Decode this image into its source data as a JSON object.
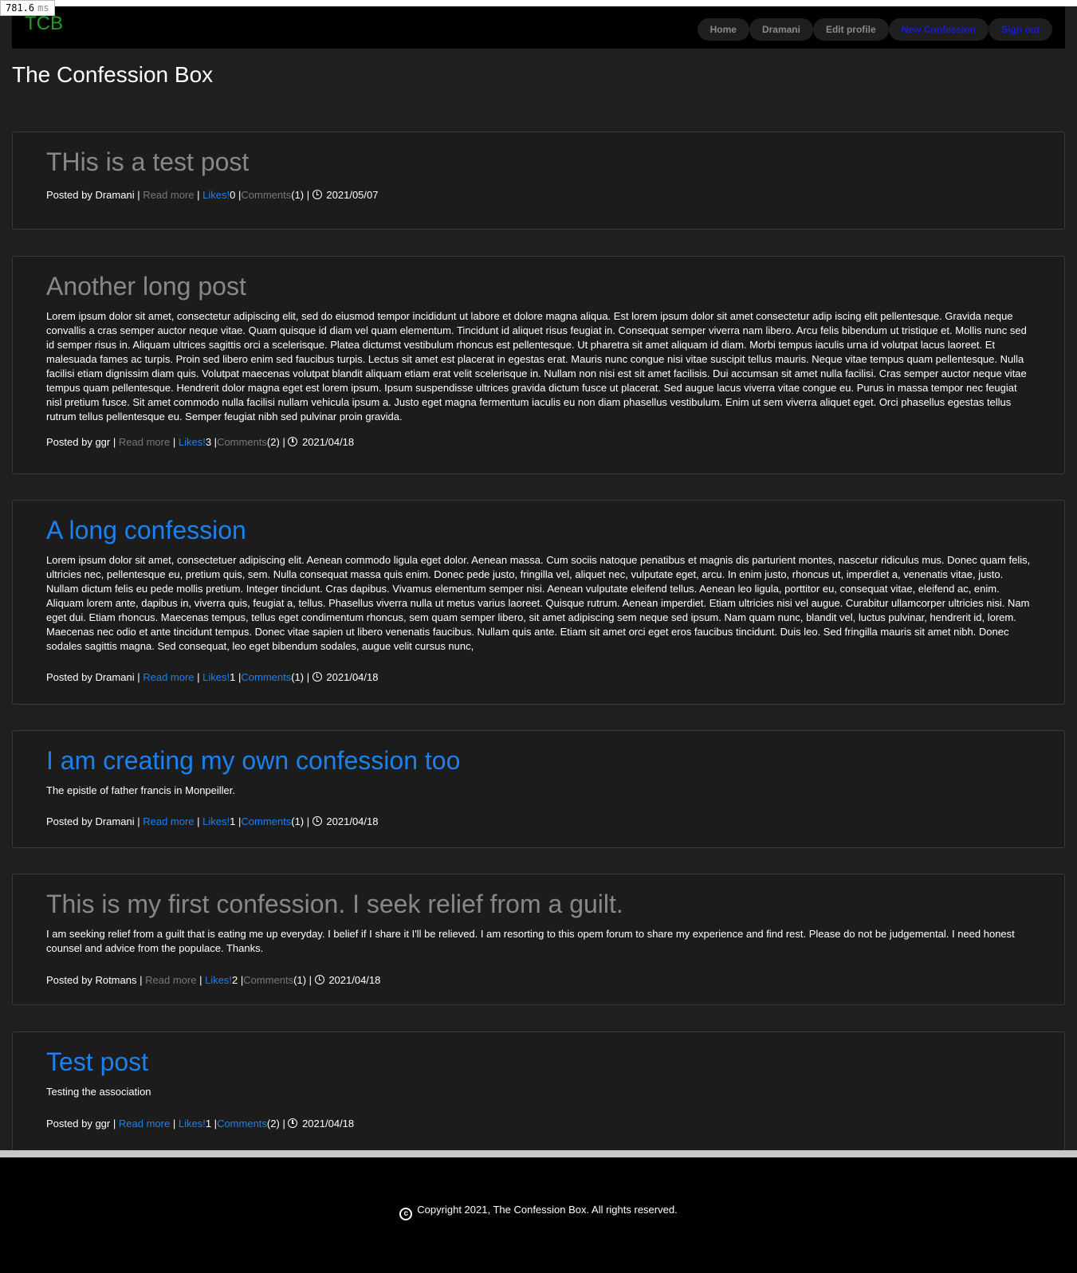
{
  "timing": {
    "value": "781.6",
    "unit": "ms"
  },
  "navbar": {
    "brand": "TCB",
    "links": [
      "Home",
      "Dramani",
      "Edit profile",
      "New Confession",
      "Sign out"
    ]
  },
  "site_title": "The Confession Box",
  "posts": [
    {
      "title": "THis is a test post",
      "body": "",
      "author": "Dramani",
      "read_more": "Read more",
      "likes_label": "Likes!",
      "likes": "0",
      "comments_label": "Comments",
      "comments": "(1)",
      "date": "2021/05/07"
    },
    {
      "title": "Another long post",
      "body": "Lorem ipsum dolor sit amet, consectetur adipiscing elit, sed do eiusmod tempor incididunt ut labore et dolore magna aliqua. Est lorem ipsum dolor sit amet consectetur adip iscing elit pellentesque. Gravida neque convallis a cras semper auctor neque vitae. Quam quisque id diam vel quam elementum. Tincidunt id aliquet risus feugiat in. Consequat semper viverra nam libero. Arcu felis bibendum ut tristique et. Mollis nunc sed id semper risus in. Aliquam ultrices sagittis orci a scelerisque. Platea dictumst vestibulum rhoncus est pellentesque. Ut pharetra sit amet aliquam id diam. Morbi tempus iaculis urna id volutpat lacus laoreet. Et malesuada fames ac turpis. Proin sed libero enim sed faucibus turpis. Lectus sit amet est placerat in egestas erat. Mauris nunc congue nisi vitae suscipit tellus mauris. Neque vitae tempus quam pellentesque. Nulla facilisi etiam dignissim diam quis. Volutpat maecenas volutpat blandit aliquam etiam erat velit scelerisque in. Nullam non nisi est sit amet facilisis. Dui accumsan sit amet nulla facilisi. Cras semper auctor neque vitae tempus quam pellentesque. Hendrerit dolor magna eget est lorem ipsum. Ipsum suspendisse ultrices gravida dictum fusce ut placerat. Sed augue lacus viverra vitae congue eu. Purus in massa tempor nec feugiat nisl pretium fusce. Sit amet commodo nulla facilisi nullam vehicula ipsum a. Justo eget magna fermentum iaculis eu non diam phasellus vestibulum. Enim ut sem viverra aliquet eget. Orci phasellus egestas tellus rutrum tellus pellentesque eu. Semper feugiat nibh sed pulvinar proin gravida.",
      "author": "ggr",
      "read_more": "Read more",
      "likes_label": "Likes!",
      "likes": "3",
      "comments_label": "Comments",
      "comments": "(2)",
      "date": "2021/04/18"
    },
    {
      "title": "A long confession",
      "body": "Lorem ipsum dolor sit amet, consectetuer adipiscing elit. Aenean commodo ligula eget dolor. Aenean massa. Cum sociis natoque penatibus et magnis dis parturient montes, nascetur ridiculus mus. Donec quam felis, ultricies nec, pellentesque eu, pretium quis, sem. Nulla consequat massa quis enim. Donec pede justo, fringilla vel, aliquet nec, vulputate eget, arcu. In enim justo, rhoncus ut, imperdiet a, venenatis vitae, justo. Nullam dictum felis eu pede mollis pretium. Integer tincidunt. Cras dapibus. Vivamus elementum semper nisi. Aenean vulputate eleifend tellus. Aenean leo ligula, porttitor eu, consequat vitae, eleifend ac, enim. Aliquam lorem ante, dapibus in, viverra quis, feugiat a, tellus. Phasellus viverra nulla ut metus varius laoreet. Quisque rutrum. Aenean imperdiet. Etiam ultricies nisi vel augue. Curabitur ullamcorper ultricies nisi. Nam eget dui. Etiam rhoncus. Maecenas tempus, tellus eget condimentum rhoncus, sem quam semper libero, sit amet adipiscing sem neque sed ipsum. Nam quam nunc, blandit vel, luctus pulvinar, hendrerit id, lorem. Maecenas nec odio et ante tincidunt tempus. Donec vitae sapien ut libero venenatis faucibus. Nullam quis ante. Etiam sit amet orci eget eros faucibus tincidunt. Duis leo. Sed fringilla mauris sit amet nibh. Donec sodales sagittis magna. Sed consequat, leo eget bibendum sodales, augue velit cursus nunc,",
      "author": "Dramani",
      "read_more": "Read more",
      "likes_label": "Likes!",
      "likes": "1",
      "comments_label": "Comments",
      "comments": "(1)",
      "date": "2021/04/18"
    },
    {
      "title": "I am creating my own confession too",
      "body": "The epistle of father francis in Monpeiller.",
      "author": "Dramani",
      "read_more": "Read more",
      "likes_label": "Likes!",
      "likes": "1",
      "comments_label": "Comments",
      "comments": "(1)",
      "date": "2021/04/18"
    },
    {
      "title": "This is my first confession. I seek relief from a guilt.",
      "body": "I am seeking relief from a guilt that is eating me up everyday. I belief if I share it I'll be relieved. I am resorting to this opem forum to share my experience and find rest. Please do not be judgemental. I need honest counsel and advice from the populace. Thanks.",
      "author": "Rotmans",
      "read_more": "Read more",
      "likes_label": "Likes!",
      "likes": "2",
      "comments_label": "Comments",
      "comments": "(1)",
      "date": "2021/04/18"
    },
    {
      "title": "Test post",
      "body": "Testing the association",
      "author": "ggr",
      "read_more": "Read more",
      "likes_label": "Likes!",
      "likes": "1",
      "comments_label": "Comments",
      "comments": "(2)",
      "date": "2021/04/18"
    }
  ],
  "meta_labels": {
    "posted_by": "Posted by",
    "sep": "|"
  },
  "footer": {
    "copyright": "Copyright 2021, The Confession Box. All rights reserved."
  },
  "colors": {
    "link": "#1a82f0",
    "muted": "#777777",
    "brand": "#1fa01f",
    "nav_accent": "#1a1adb"
  }
}
